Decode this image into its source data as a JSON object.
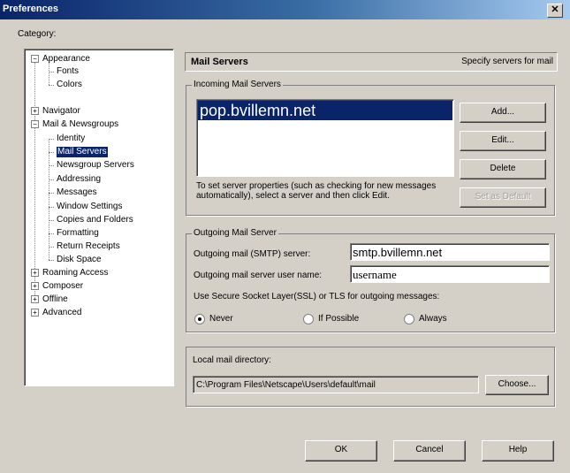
{
  "window": {
    "title": "Preferences"
  },
  "category_label": "Category:",
  "tree": [
    {
      "label": "Appearance"
    },
    {
      "label": "Fonts"
    },
    {
      "label": "Colors"
    },
    {
      "label": "Navigator"
    },
    {
      "label": "Mail & Newsgroups"
    },
    {
      "label": "Identity"
    },
    {
      "label": "Mail Servers"
    },
    {
      "label": "Newsgroup Servers"
    },
    {
      "label": "Addressing"
    },
    {
      "label": "Messages"
    },
    {
      "label": "Window Settings"
    },
    {
      "label": "Copies and Folders"
    },
    {
      "label": "Formatting"
    },
    {
      "label": "Return Receipts"
    },
    {
      "label": "Disk Space"
    },
    {
      "label": "Roaming Access"
    },
    {
      "label": "Composer"
    },
    {
      "label": "Offline"
    },
    {
      "label": "Advanced"
    }
  ],
  "panel": {
    "title": "Mail Servers",
    "subtitle": "Specify servers for mail"
  },
  "incoming": {
    "legend": "Incoming Mail Servers",
    "servers": [
      "pop.bvillemn.net"
    ],
    "add": "Add...",
    "edit": "Edit...",
    "delete": "Delete",
    "set_default": "Set as Default",
    "hint": "To set server properties (such as checking for new messages automatically), select a server and then click Edit."
  },
  "outgoing": {
    "legend": "Outgoing Mail Server",
    "server_label": "Outgoing mail (SMTP) server:",
    "server_value": "smtp.bvillemn.net",
    "user_label": "Outgoing mail server user name:",
    "user_value": "username",
    "ssl_label": "Use Secure Socket Layer(SSL) or TLS for outgoing messages:",
    "options": [
      "Never",
      "If Possible",
      "Always"
    ],
    "selected": "Never"
  },
  "local": {
    "label": "Local mail directory:",
    "path": "C:\\Program Files\\Netscape\\Users\\default\\mail",
    "choose": "Choose..."
  },
  "footer": {
    "ok": "OK",
    "cancel": "Cancel",
    "help": "Help"
  }
}
